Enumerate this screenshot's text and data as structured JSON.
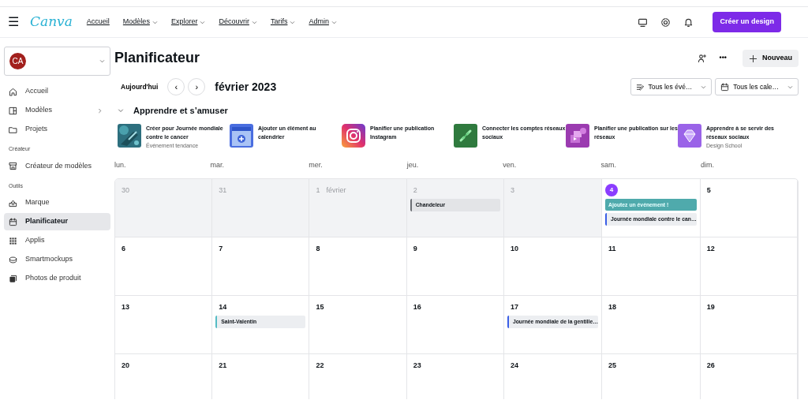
{
  "topbar": {
    "logo": "Canva",
    "menu_icon": "☰",
    "nav": [
      {
        "label": "Accueil",
        "dropdown": false
      },
      {
        "label": "Modèles",
        "dropdown": true
      },
      {
        "label": "Explorer",
        "dropdown": true
      },
      {
        "label": "Découvrir",
        "dropdown": true
      },
      {
        "label": "Tarifs",
        "dropdown": true
      },
      {
        "label": "Admin",
        "dropdown": true
      }
    ],
    "create_button": "Créer un design"
  },
  "sidebar": {
    "account": {
      "initials": "CA"
    },
    "sections": [
      {
        "items": [
          {
            "label": "Accueil",
            "selected": false,
            "submenu": false
          },
          {
            "label": "Modèles",
            "selected": false,
            "submenu": true
          },
          {
            "label": "Projets",
            "selected": false,
            "submenu": false
          }
        ]
      },
      {
        "heading": "Créateur",
        "items": [
          {
            "label": "Créateur de modèles",
            "selected": false,
            "submenu": false
          }
        ]
      },
      {
        "heading": "Outils",
        "items": [
          {
            "label": "Marque",
            "selected": false,
            "submenu": false
          },
          {
            "label": "Planificateur",
            "selected": true,
            "submenu": false
          },
          {
            "label": "Applis",
            "selected": false,
            "submenu": false
          },
          {
            "label": "Smartmockups",
            "selected": false,
            "submenu": false
          },
          {
            "label": "Photos de produit",
            "selected": false,
            "submenu": false
          }
        ]
      }
    ]
  },
  "header": {
    "title": "Planificateur",
    "new_button": "Nouveau",
    "more_icon": "•••"
  },
  "toolbar": {
    "today_button": "Aujourd'hui",
    "prev": "‹",
    "next": "›",
    "month": "février 2023",
    "filters": [
      {
        "label": "Tous les évé…"
      },
      {
        "label": "Tous les cale…"
      }
    ]
  },
  "learn": {
    "title": "Apprendre et s’amuser",
    "expanded": true,
    "cards": [
      {
        "title": "Créer pour Journée mondiale contre le cancer",
        "subtitle": "Événement tendance"
      },
      {
        "title": "Ajouter un élément au calendrier"
      },
      {
        "title": "Planifier une publication Instagram"
      },
      {
        "title": "Connecter les comptes réseaux sociaux"
      },
      {
        "title": "Planifier une publication sur les réseaux"
      },
      {
        "title": "Apprendre à se servir des réseaux sociaux",
        "subtitle": "Design School"
      }
    ]
  },
  "calendar": {
    "weekdays": [
      "lun.",
      "mar.",
      "mer.",
      "jeu.",
      "ven.",
      "sam.",
      "dim."
    ],
    "weeks": [
      [
        {
          "day": "30",
          "past": true,
          "today": false
        },
        {
          "day": "31",
          "past": true,
          "today": false
        },
        {
          "day": "1",
          "month_label": "février",
          "past": true,
          "today": false
        },
        {
          "day": "2",
          "past": true,
          "today": false,
          "events": [
            {
              "kind": "event",
              "title": "Chandeleur",
              "color": "#6b6e74"
            }
          ]
        },
        {
          "day": "3",
          "past": true,
          "today": false
        },
        {
          "day": "4",
          "past": false,
          "today": true,
          "events": [
            {
              "kind": "action",
              "title": "Ajoutez un événement !"
            },
            {
              "kind": "event",
              "title": "Journée mondiale contre le can…",
              "color": "#3a5ee6"
            }
          ]
        },
        {
          "day": "5",
          "past": false,
          "today": false
        }
      ],
      [
        {
          "day": "6",
          "past": false,
          "today": false
        },
        {
          "day": "7",
          "past": false,
          "today": false
        },
        {
          "day": "8",
          "past": false,
          "today": false
        },
        {
          "day": "9",
          "past": false,
          "today": false
        },
        {
          "day": "10",
          "past": false,
          "today": false
        },
        {
          "day": "11",
          "past": false,
          "today": false
        },
        {
          "day": "12",
          "past": false,
          "today": false
        }
      ],
      [
        {
          "day": "13",
          "past": false,
          "today": false
        },
        {
          "day": "14",
          "past": false,
          "today": false,
          "events": [
            {
              "kind": "event",
              "title": "Saint-Valentin",
              "color": "#55bcc4"
            }
          ]
        },
        {
          "day": "15",
          "past": false,
          "today": false
        },
        {
          "day": "16",
          "past": false,
          "today": false
        },
        {
          "day": "17",
          "past": false,
          "today": false,
          "events": [
            {
              "kind": "event",
              "title": "Journée mondiale de la gentille…",
              "color": "#3a5ee6"
            }
          ]
        },
        {
          "day": "18",
          "past": false,
          "today": false
        },
        {
          "day": "19",
          "past": false,
          "today": false
        }
      ],
      [
        {
          "day": "20",
          "past": false,
          "today": false
        },
        {
          "day": "21",
          "past": false,
          "today": false
        },
        {
          "day": "22",
          "past": false,
          "today": false
        },
        {
          "day": "23",
          "past": false,
          "today": false
        },
        {
          "day": "24",
          "past": false,
          "today": false
        },
        {
          "day": "25",
          "past": false,
          "today": false
        },
        {
          "day": "26",
          "past": false,
          "today": false
        }
      ]
    ]
  }
}
